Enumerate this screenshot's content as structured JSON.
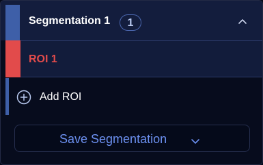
{
  "segmentation": {
    "title": "Segmentation 1",
    "count": "1",
    "accent_color": "#3e5fa8",
    "expanded_icon": "chevron-up-icon"
  },
  "roi": {
    "label": "ROI 1",
    "color": "#e24b4b"
  },
  "add_roi": {
    "label": "Add ROI",
    "icon": "plus-circle-icon"
  },
  "save_button": {
    "label": "Save Segmentation",
    "icon": "chevron-down-icon",
    "color": "#6c90f0"
  }
}
